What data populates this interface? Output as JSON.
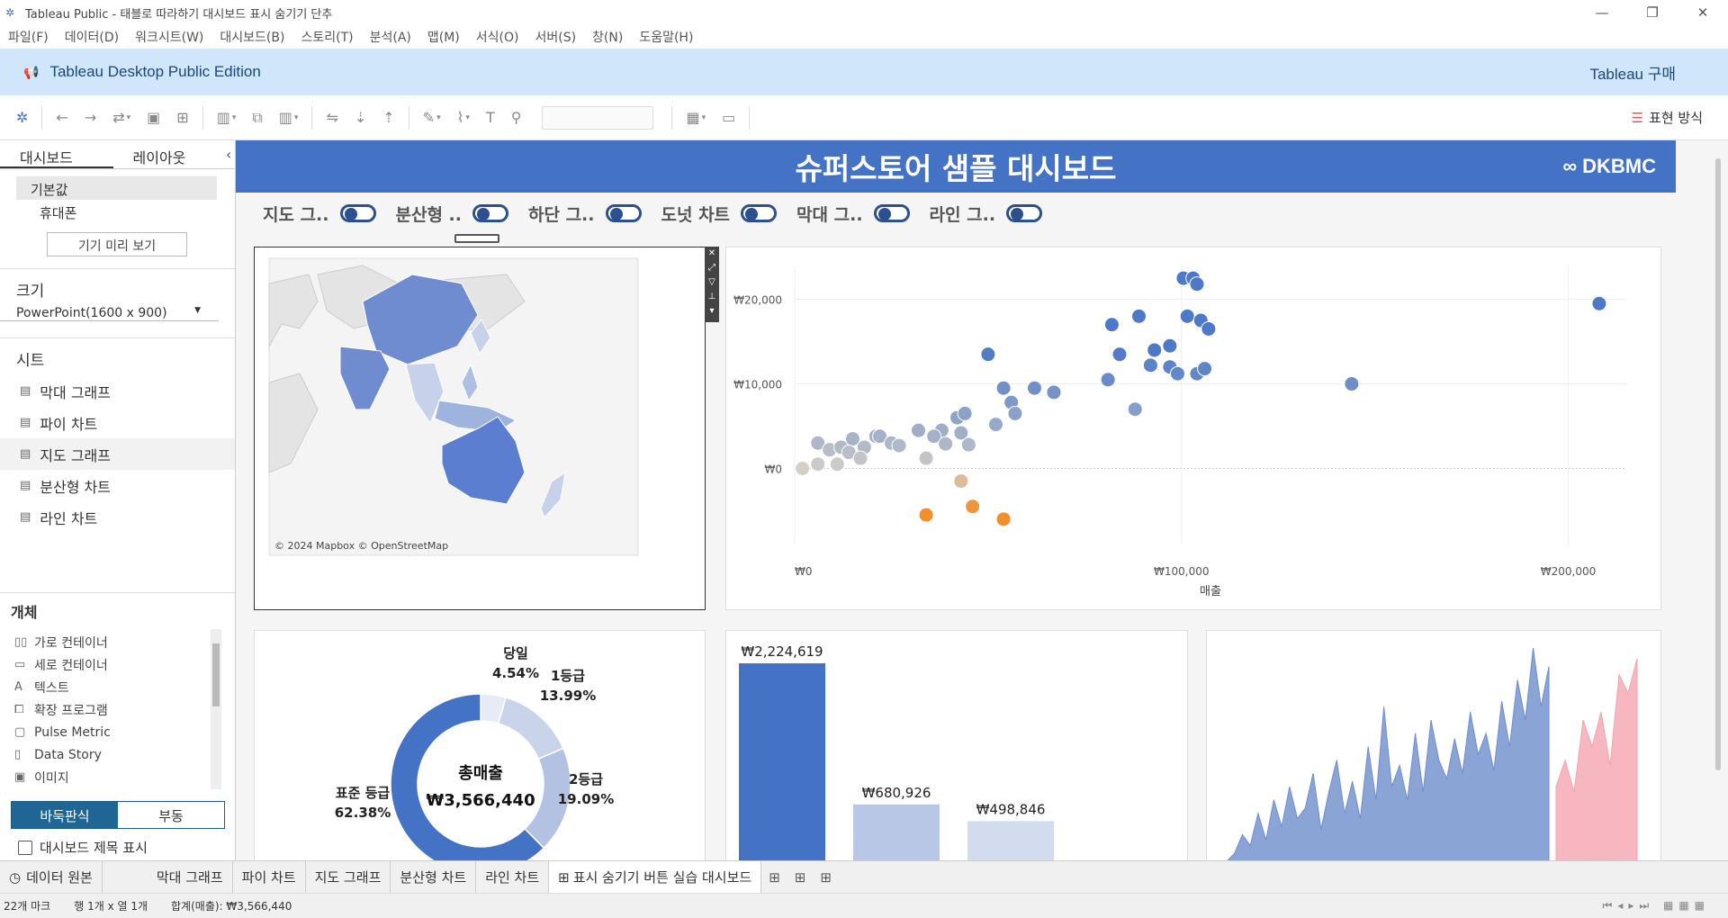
{
  "window": {
    "title": "Tableau Public - 태블로 따라하기 대시보드 표시 숨기기 단추",
    "controls": [
      "—",
      "❐",
      "✕"
    ]
  },
  "menu": [
    "파일(F)",
    "데이터(D)",
    "워크시트(W)",
    "대시보드(B)",
    "스토리(T)",
    "분석(A)",
    "맵(M)",
    "서식(O)",
    "서버(S)",
    "창(N)",
    "도움말(H)"
  ],
  "banner": {
    "edition": "Tableau Desktop Public Edition",
    "buy": "Tableau 구매",
    "color": "#d0e7fb"
  },
  "toolbar": {
    "show_me": "표현 방식"
  },
  "left_panel": {
    "tabs": [
      "대시보드",
      "레이아웃"
    ],
    "devices": [
      "기본값",
      "휴대폰"
    ],
    "preview_button": "기기 미리 보기",
    "size_title": "크기",
    "size_value": "PowerPoint(1600 x 900)",
    "sheets_title": "시트",
    "sheets": [
      "막대 그래프",
      "파이 차트",
      "지도 그래프",
      "분산형 차트",
      "라인 차트"
    ],
    "objects_title": "개체",
    "objects": [
      {
        "label": "가로 컨테이너",
        "icon": "horizontal-container-icon"
      },
      {
        "label": "세로 컨테이너",
        "icon": "vertical-container-icon"
      },
      {
        "label": "텍스트",
        "icon": "text-icon"
      },
      {
        "label": "확장 프로그램",
        "icon": "extension-icon"
      },
      {
        "label": "Pulse Metric",
        "icon": "pulse-metric-icon"
      },
      {
        "label": "Data Story",
        "icon": "data-story-icon"
      },
      {
        "label": "이미지",
        "icon": "image-icon"
      }
    ],
    "layout_toggle": [
      "바둑판식",
      "부동"
    ],
    "show_title_label": "대시보드 제목 표시"
  },
  "dashboard": {
    "title": "슈퍼스토어 샘플 대시보드",
    "logo_text": "DKBMC",
    "title_bg": "#4472c4",
    "toggles": [
      "지도 그..",
      "분산형 ..",
      "하단 그..",
      "도넛 차트",
      "막대 그..",
      "라인 그.."
    ],
    "map_credit": "© 2024 Mapbox © OpenStreetMap"
  },
  "chart_data": [
    {
      "type": "scatter",
      "xlabel": "매출",
      "ylabel": "",
      "xlim": [
        0,
        215000
      ],
      "ylim": [
        -9000,
        24000
      ],
      "x_ticks": [
        "₩0",
        "₩100,000",
        "₩200,000"
      ],
      "y_ticks": [
        "₩20,000",
        "₩10,000",
        "₩0"
      ],
      "points": [
        [
          100500,
          22500
        ],
        [
          103000,
          22500
        ],
        [
          104000,
          21800
        ],
        [
          82000,
          17000
        ],
        [
          89000,
          18000
        ],
        [
          101500,
          18000
        ],
        [
          105000,
          17500
        ],
        [
          107000,
          16500
        ],
        [
          50000,
          13500
        ],
        [
          84000,
          13500
        ],
        [
          93000,
          14000
        ],
        [
          97000,
          14500
        ],
        [
          92000,
          12200
        ],
        [
          97000,
          12000
        ],
        [
          99000,
          11200
        ],
        [
          104000,
          11200
        ],
        [
          106000,
          11800
        ],
        [
          81000,
          10500
        ],
        [
          144000,
          10000
        ],
        [
          208000,
          19500
        ],
        [
          54000,
          9500
        ],
        [
          62000,
          9500
        ],
        [
          67000,
          9000
        ],
        [
          56000,
          7800
        ],
        [
          57000,
          6500
        ],
        [
          88000,
          7000
        ],
        [
          42000,
          6000
        ],
        [
          44000,
          6500
        ],
        [
          52000,
          5200
        ],
        [
          32000,
          4500
        ],
        [
          38000,
          4500
        ],
        [
          43000,
          4200
        ],
        [
          36000,
          3800
        ],
        [
          15000,
          3500
        ],
        [
          21000,
          3800
        ],
        [
          22000,
          3800
        ],
        [
          25000,
          3000
        ],
        [
          27000,
          2700
        ],
        [
          18000,
          2500
        ],
        [
          39000,
          2900
        ],
        [
          45000,
          2800
        ],
        [
          6000,
          3000
        ],
        [
          9000,
          2200
        ],
        [
          12000,
          2500
        ],
        [
          14000,
          1900
        ],
        [
          17000,
          1200
        ],
        [
          2000,
          0
        ],
        [
          6000,
          500
        ],
        [
          11000,
          500
        ],
        [
          34000,
          1200
        ],
        [
          43000,
          -1500
        ],
        [
          46000,
          -4500
        ],
        [
          34000,
          -5500
        ],
        [
          54000,
          -6000
        ]
      ],
      "color_scale": {
        "low": "#f28e2b",
        "mid": "#d4d0c8",
        "high": "#4e79c8"
      }
    },
    {
      "type": "pie",
      "title": "총매출",
      "total": "₩3,566,440",
      "slices": [
        {
          "name": "당일",
          "value": 4.54,
          "label": "4.54%",
          "color": "#e6ebf5"
        },
        {
          "name": "1등급",
          "value": 13.99,
          "label": "13.99%",
          "color": "#c9d3e9"
        },
        {
          "name": "2등급",
          "value": 19.09,
          "label": "19.09%",
          "color": "#b3c2e3"
        },
        {
          "name": "표준 등급",
          "value": 62.38,
          "label": "62.38%",
          "color": "#4472c4"
        }
      ]
    },
    {
      "type": "bar",
      "values": [
        2224619,
        680926,
        498846
      ],
      "value_labels": [
        "₩2,224,619",
        "₩680,926",
        "₩498,846"
      ],
      "colors": [
        "#4472c4",
        "#b8c7e6",
        "#d3dcef"
      ]
    },
    {
      "type": "area",
      "series": [
        {
          "values": [
            2,
            5,
            12,
            8,
            20,
            10,
            25,
            15,
            30,
            18,
            22,
            35,
            14,
            28,
            40,
            20,
            32,
            18,
            45,
            25,
            60,
            30,
            38,
            25,
            50,
            28,
            55,
            40,
            33,
            48,
            35,
            58,
            42,
            50,
            36,
            62,
            45,
            70,
            55,
            82,
            60,
            75
          ],
          "color": "#8aa4d6"
        },
        {
          "values": [
            30,
            40,
            28,
            55,
            45,
            58,
            38,
            72,
            65,
            78
          ],
          "color": "#f7b7c0"
        }
      ]
    }
  ],
  "tabs": {
    "data_source": "데이터 원본",
    "sheets": [
      "막대 그래프",
      "파이 차트",
      "지도 그래프",
      "분산형 차트",
      "라인 차트"
    ],
    "active_dashboard": "표시 숨기기 버튼 실습 대시보드"
  },
  "status": {
    "marks": "22개 마크",
    "rows_cols": "행 1개 x 열 1개",
    "sum": "합계(매출): ₩3,566,440"
  }
}
